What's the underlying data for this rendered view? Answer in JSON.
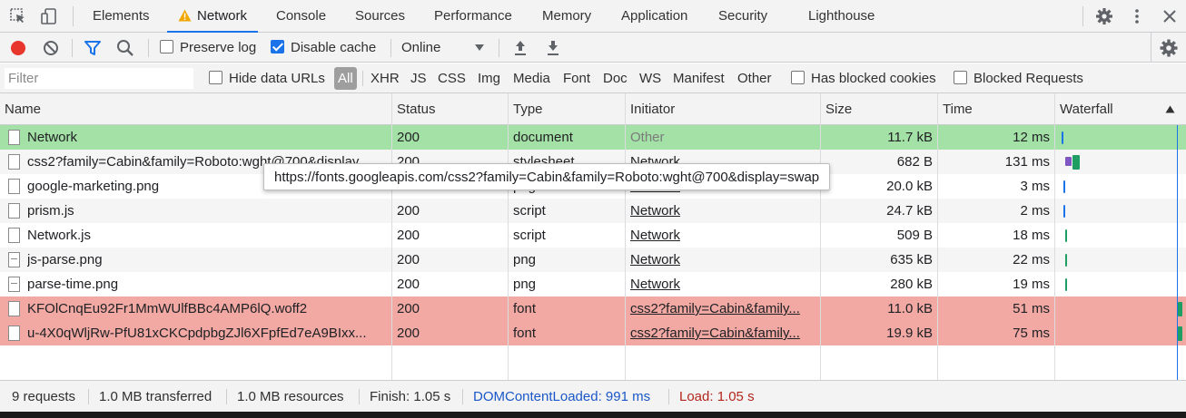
{
  "tabs": [
    "Elements",
    "Network",
    "Console",
    "Sources",
    "Performance",
    "Memory",
    "Application",
    "Security",
    "Lighthouse"
  ],
  "toolbar": {
    "preserve_log": "Preserve log",
    "disable_cache": "Disable cache",
    "throttle": "Online",
    "preserve_log_checked": false,
    "disable_cache_checked": true
  },
  "filter": {
    "placeholder": "Filter",
    "hide_data_urls": "Hide data URLs",
    "types": [
      "All",
      "XHR",
      "JS",
      "CSS",
      "Img",
      "Media",
      "Font",
      "Doc",
      "WS",
      "Manifest",
      "Other"
    ],
    "has_blocked_cookies": "Has blocked cookies",
    "blocked_requests": "Blocked Requests"
  },
  "table": {
    "columns": [
      "Name",
      "Status",
      "Type",
      "Initiator",
      "Size",
      "Time",
      "Waterfall"
    ],
    "rows": [
      {
        "name": "Network",
        "status": "200",
        "type": "document",
        "initiator": "Other",
        "size": "11.7 kB",
        "time": "12 ms"
      },
      {
        "name": "css2?family=Cabin&family=Roboto:wght@700&display",
        "status": "200",
        "type": "stylesheet",
        "initiator": "Network",
        "size": "682 B",
        "time": "131 ms"
      },
      {
        "name": "google-marketing.png",
        "status": "200",
        "type": "png",
        "initiator": "Network",
        "size": "20.0 kB",
        "time": "3 ms"
      },
      {
        "name": "prism.js",
        "status": "200",
        "type": "script",
        "initiator": "Network",
        "size": "24.7 kB",
        "time": "2 ms"
      },
      {
        "name": "Network.js",
        "status": "200",
        "type": "script",
        "initiator": "Network",
        "size": "509 B",
        "time": "18 ms"
      },
      {
        "name": "js-parse.png",
        "status": "200",
        "type": "png",
        "initiator": "Network",
        "size": "635 kB",
        "time": "22 ms"
      },
      {
        "name": "parse-time.png",
        "status": "200",
        "type": "png",
        "initiator": "Network",
        "size": "280 kB",
        "time": "19 ms"
      },
      {
        "name": "KFOlCnqEu92Fr1MmWUlfBBc4AMP6lQ.woff2",
        "status": "200",
        "type": "font",
        "initiator": "css2?family=Cabin&family...",
        "size": "11.0 kB",
        "time": "51 ms"
      },
      {
        "name": "u-4X0qWljRw-PfU81xCKCpdpbgZJl6XFpfEd7eA9BIxx...",
        "status": "200",
        "type": "font",
        "initiator": "css2?family=Cabin&family...",
        "size": "19.9 kB",
        "time": "75 ms"
      }
    ]
  },
  "tooltip": "https://fonts.googleapis.com/css2?family=Cabin&family=Roboto:wght@700&display=swap",
  "status": {
    "requests": "9 requests",
    "transferred": "1.0 MB transferred",
    "resources": "1.0 MB resources",
    "finish": "Finish: 1.05 s",
    "dcl": "DOMContentLoaded: 991 ms",
    "load": "Load: 1.05 s"
  },
  "colors": {
    "accent": "#1a73e8",
    "record": "#e8362c",
    "doc_row": "#a4e1a6",
    "failed_row": "#f2a9a4",
    "dcl": "#1a57c8",
    "load": "#b3261e"
  }
}
